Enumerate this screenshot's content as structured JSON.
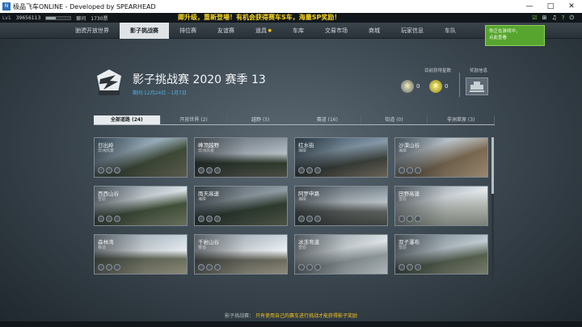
{
  "window": {
    "title": "极品飞车ONLINE - Developed by SPEARHEAD",
    "controls": [
      "—",
      "□",
      "✕"
    ]
  },
  "topstrip": {
    "level": "Lv1",
    "uid": "39656113",
    "xp_fraction": 0.4,
    "stat_a": "聊问",
    "stat_b": "1730票",
    "banner": "卿升级，重新登場！有机会获得赛车S车，海量SP奖励！",
    "icons": [
      "checkbox-icon",
      "gift-icon",
      "bell-icon",
      "help-icon",
      "power-icon"
    ]
  },
  "nav": {
    "items": [
      {
        "label": "驰骋开放世界",
        "active": false,
        "new": false
      },
      {
        "label": "影子挑战赛",
        "active": true,
        "new": false
      },
      {
        "label": "排位赛",
        "active": false,
        "new": false
      },
      {
        "label": "友谊赛",
        "active": false,
        "new": false
      },
      {
        "label": "道具",
        "active": false,
        "new": true
      },
      {
        "label": "车库",
        "active": false,
        "new": false
      },
      {
        "label": "交易市场",
        "active": false,
        "new": false
      },
      {
        "label": "商城",
        "active": false,
        "new": false
      },
      {
        "label": "玩家信息",
        "active": false,
        "new": false
      },
      {
        "label": "车队",
        "active": false,
        "new": false
      }
    ],
    "toast_line1": "你正在游戏中，",
    "toast_line2": "点此查看"
  },
  "header": {
    "title": "影子挑战赛 2020 赛季 13",
    "date": "期间:12月24日 - 1月7日",
    "stars_caption": "目前获得星数",
    "reward_caption": "奖励信息",
    "silver_count": "0",
    "gold_count": "0"
  },
  "tabs": [
    {
      "label": "全部道路 (24)",
      "active": true
    },
    {
      "label": "开放世界 (2)",
      "active": false
    },
    {
      "label": "越野 (5)",
      "active": false
    },
    {
      "label": "赛道 (16)",
      "active": false
    },
    {
      "label": "街道 (0)",
      "active": false
    },
    {
      "label": "非洲草原 (3)",
      "active": false
    }
  ],
  "tracks": [
    {
      "name": "日出岭",
      "type": "非洲风景",
      "stars": 3,
      "bg": "linear-gradient(160deg,#6f8fa8 0%,#a7bcc9 35%,#3e4a37 60%,#5a5a4e 100%)"
    },
    {
      "name": "峰顶越野",
      "type": "非洲风景",
      "stars": 3,
      "bg": "linear-gradient(180deg,#8a96a0 0%,#b6bfc6 40%,#2f3a2c 65%,#4a4d44 100%)"
    },
    {
      "name": "红水街",
      "type": "海岸",
      "stars": 3,
      "bg": "linear-gradient(170deg,#4f6a7f 0%,#879cab 35%,#3b3f3a 65%,#6b6356 100%)"
    },
    {
      "name": "沙漠山谷",
      "type": "海岸",
      "stars": 3,
      "bg": "linear-gradient(160deg,#9bb3c6 0%,#d2dbe2 30%,#7c6a52 60%,#9a8870 100%)"
    },
    {
      "name": "西西山谷",
      "type": "雪原",
      "stars": 3,
      "bg": "linear-gradient(170deg,#a6b7c3 0%,#dde4e8 35%,#41513a 60%,#6a6e5d 100%)"
    },
    {
      "name": "雨天高速",
      "type": "海岸",
      "stars": 3,
      "bg": "linear-gradient(170deg,#6e7a82 0%,#939fa7 35%,#2e3b2e 60%,#4d5246 100%)"
    },
    {
      "name": "阿罗申路",
      "type": "海岸",
      "stars": 3,
      "bg": "linear-gradient(180deg,#808c94 0%,#b9c2c8 40%,#5c5f5c 65%,#3f4440 100%)"
    },
    {
      "name": "田野高速",
      "type": "雪原",
      "stars": 3,
      "bg": "linear-gradient(170deg,#b3c2cc 0%,#e5eaee 35%,#b8bdb6 60%,#797f76 100%)"
    },
    {
      "name": "森林湾",
      "type": "赛道",
      "stars": 3,
      "bg": "linear-gradient(180deg,#c6d3dc 0%,#e7edf1 40%,#6a6f5e 62%,#8a8877 100%)"
    },
    {
      "name": "千岩山谷",
      "type": "赛道",
      "stars": 3,
      "bg": "linear-gradient(180deg,#c9d4dc 0%,#edf1f4 40%,#6b6b5e 65%,#8e8b7c 100%)"
    },
    {
      "name": "冰冻弯道",
      "type": "雪原",
      "stars": 3,
      "bg": "linear-gradient(170deg,#b9c3c9 0%,#dfe5e8 40%,#8e979b 65%,#aeb5b8 100%)"
    },
    {
      "name": "双子瀑布",
      "type": "雪原",
      "stars": 3,
      "bg": "linear-gradient(170deg,#94a3ad 0%,#c3ced5 40%,#56604f 65%,#787c6d 100%)"
    }
  ],
  "scroll": {
    "position_fraction": 0.0,
    "visible_fraction": 0.4
  },
  "footer": {
    "prefix": "影子挑战赛：",
    "highlight": "只有使用自己的赛车进行挑战才能获得影子奖励"
  }
}
